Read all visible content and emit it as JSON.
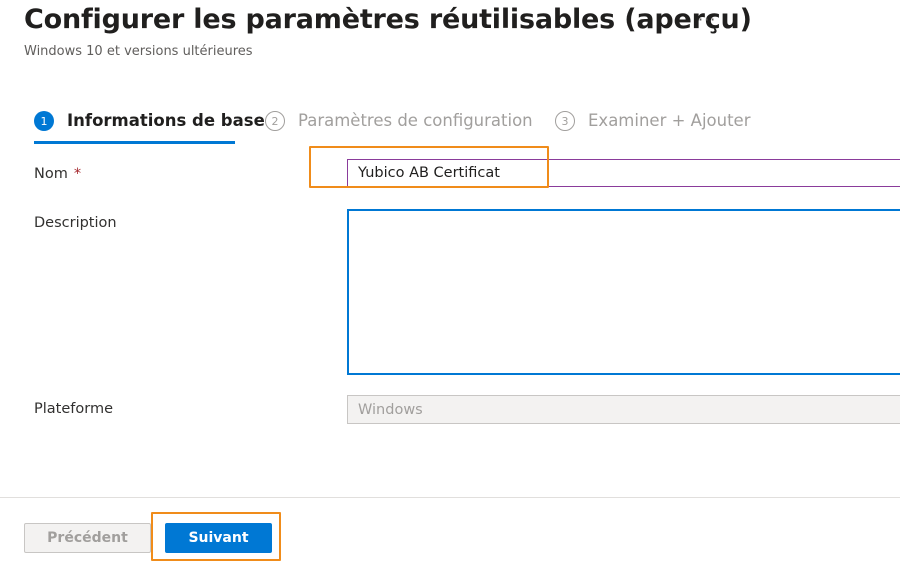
{
  "header": {
    "title": "Configurer les paramètres réutilisables (aperçu)",
    "more_label": "···",
    "subtitle": "Windows 10 et versions ultérieures"
  },
  "steps": [
    {
      "number": "1",
      "label": "Informations de base",
      "state": "active"
    },
    {
      "number": "2",
      "label": "Paramètres de configuration",
      "state": "inactive"
    },
    {
      "number": "3",
      "label": "Examiner + Ajouter",
      "state": "inactive"
    }
  ],
  "form": {
    "name": {
      "label": "Nom",
      "required_mark": "*",
      "value": "Yubico AB Certificat"
    },
    "description": {
      "label": "Description",
      "value": ""
    },
    "platform": {
      "label": "Plateforme",
      "value": "Windows"
    }
  },
  "footer": {
    "previous_label": "Précédent",
    "next_label": "Suivant"
  },
  "colors": {
    "accent": "#0078d4",
    "highlight": "#f08c1a",
    "required": "#a4262c"
  }
}
